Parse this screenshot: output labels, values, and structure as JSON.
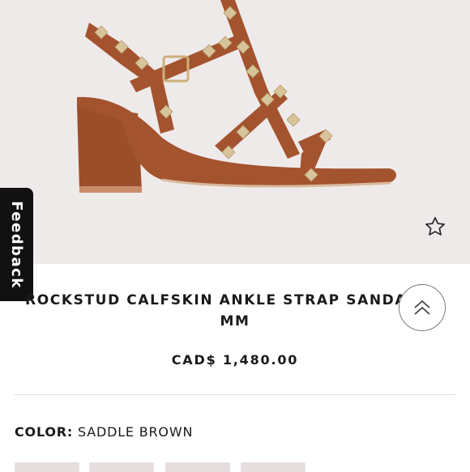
{
  "product": {
    "title_line1": "ROCKSTUD CALFSKIN ANKLE STRAP SANDAL 60",
    "title_line2": "MM",
    "price": "CAD$ 1,480.00",
    "color_label": "COLOR:",
    "color_value": "SADDLE BROWN"
  },
  "feedback": {
    "label": "Feedback"
  },
  "icons": {
    "wishlist": "star-outline-icon",
    "scroll_top": "double-chevron-up-icon"
  },
  "colors": {
    "hero_background": "#efeaea",
    "leather": "#a4532f",
    "stud": "#d8c49a",
    "feedback_background": "#111111"
  }
}
